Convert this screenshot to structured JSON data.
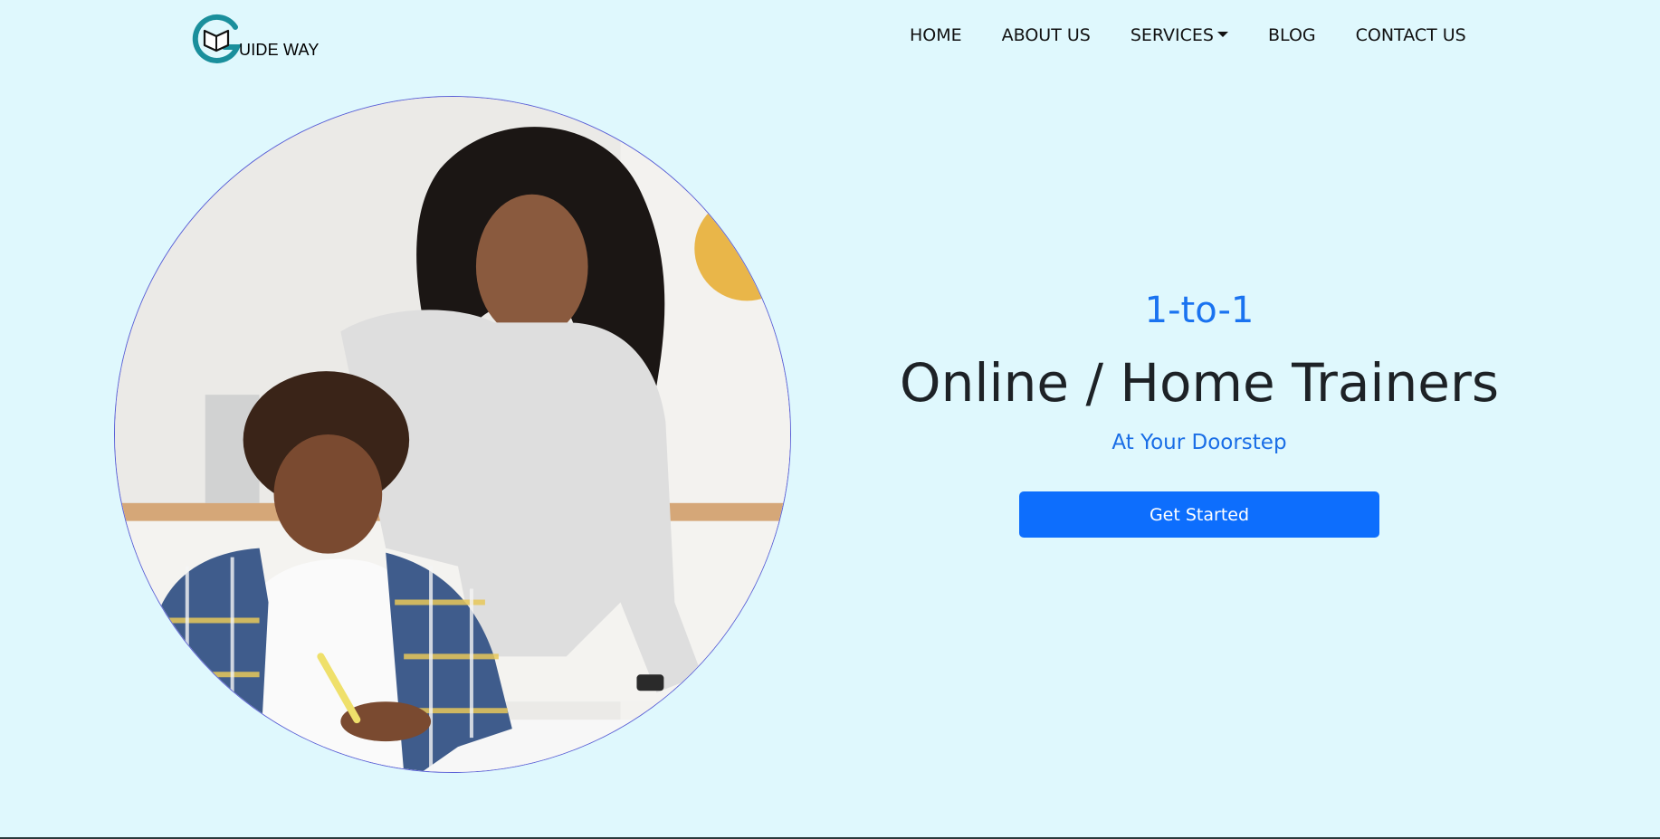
{
  "brand": {
    "logo_icon": "guide-way-logo-icon",
    "text": "UIDE WAY"
  },
  "nav": {
    "items": [
      {
        "label": "HOME"
      },
      {
        "label": "ABOUT US"
      },
      {
        "label": "SERVICES",
        "has_dropdown": true
      },
      {
        "label": "BLOG"
      },
      {
        "label": "CONTACT US"
      }
    ]
  },
  "hero": {
    "image": "hero-photo-tutor-with-student",
    "eyebrow": "1-to-1",
    "headline": "Online / Home Trainers",
    "subheadline": "At Your Doorstep",
    "cta_label": "Get Started"
  },
  "colors": {
    "background": "#dff8fd",
    "accent": "#0d6efd",
    "accent_text": "#1a73f0",
    "headline": "#1d2226",
    "logo_teal": "#1a8f9c",
    "circle_border": "#5a5fd6"
  }
}
